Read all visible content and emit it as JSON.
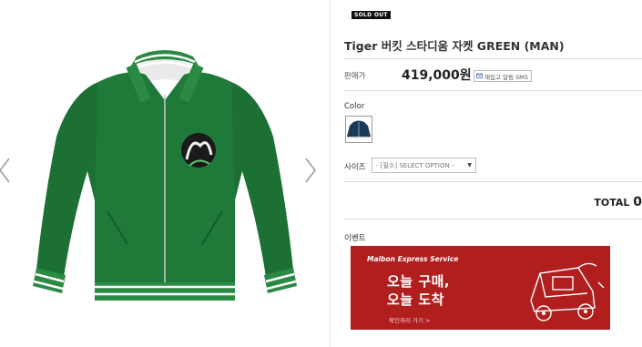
{
  "product": {
    "badge": "SOLD OUT",
    "title": "Tiger 버킷 스타디움 자켓 GREEN (MAN)",
    "price_label": "판매가",
    "price": "419,000원",
    "sms_button": "재입고 알림 SMS",
    "color_label": "Color",
    "size_label": "사이즈",
    "size_select": "- [필수] SELECT OPTION -",
    "total_label": "TOTAL",
    "total_value": "0",
    "event_label": "이벤트"
  },
  "banner": {
    "service": "Malbon Express Service",
    "line1": "오늘 구매,",
    "line2": "오늘 도착",
    "cta": "확인하러 가기 >"
  },
  "colors": {
    "jacket": "#1f7a3a",
    "banner": "#b01e1e"
  },
  "icons": [
    "chevron-left-icon",
    "chevron-right-icon",
    "sms-icon",
    "caret-down-icon"
  ]
}
